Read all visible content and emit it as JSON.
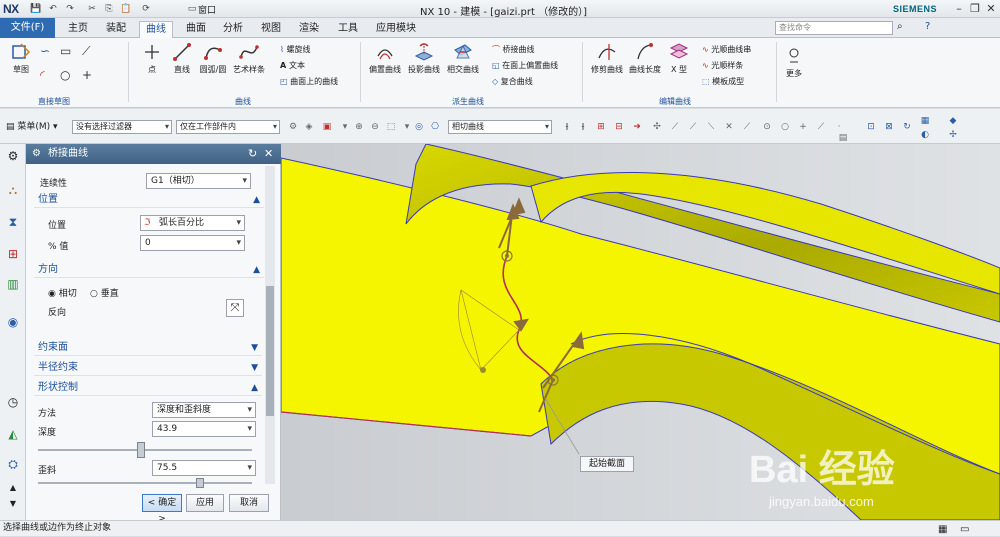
{
  "app": {
    "logo": "NX",
    "window_title": "NX 10 - 建模 - [gaizi.prt （修改的）]",
    "brand": "SIEMENS",
    "window_menu": "窗口",
    "quick_access": [
      "save-icon",
      "undo-icon",
      "redo-icon",
      "cut-icon",
      "copy-icon",
      "paste-icon",
      "repeat-icon",
      "window-icon"
    ]
  },
  "menu": {
    "file": "文件(F)",
    "tabs": [
      "主页",
      "装配",
      "曲线",
      "曲面",
      "分析",
      "视图",
      "渲染",
      "工具",
      "应用模块"
    ],
    "active_tab": "曲线",
    "search_placeholder": "查找命令"
  },
  "ribbon": {
    "sketch": {
      "label": "草图",
      "group": "直接草图"
    },
    "curve_group": {
      "label": "曲线",
      "buttons": [
        "点",
        "直线",
        "圆弧/圆",
        "艺术样条"
      ],
      "small": [
        "螺旋线",
        "文本",
        "曲面上的曲线"
      ]
    },
    "derived_group": {
      "label": "派生曲线",
      "buttons": [
        "偏置曲线",
        "投影曲线",
        "相交曲线"
      ],
      "small": [
        "桥接曲线",
        "在面上偏置曲线",
        "复合曲线"
      ]
    },
    "edit_group": {
      "label": "编辑曲线",
      "buttons": [
        "修剪曲线",
        "曲线长度",
        "X 型"
      ],
      "small": [
        "光顺曲线串",
        "光顺样条",
        "模板成型"
      ]
    },
    "more": "更多"
  },
  "toolbar": {
    "menu": "菜单(M)",
    "filter": "没有选择过滤器",
    "scope": "仅在工作部件内",
    "curve_rule": "相切曲线"
  },
  "panel": {
    "title": "桥接曲线",
    "continuity_label": "连续性",
    "continuity_value": "G1（相切）",
    "position_section": "位置",
    "position_label": "位置",
    "position_value": "弧长百分比",
    "percent_label": "% 值",
    "percent_value": "0",
    "direction_section": "方向",
    "radio_tangent": "相切",
    "radio_normal": "垂直",
    "reverse_label": "反向",
    "constraint_face": "约束面",
    "radius_constraint": "半径约束",
    "shape_control": "形状控制",
    "method_label": "方法",
    "method_value": "深度和歪斜度",
    "depth_label": "深度",
    "depth_value": "43.9",
    "depth_slider": 0.48,
    "skew_label": "歪斜",
    "skew_value": "75.5",
    "skew_slider": 0.755,
    "ok": "< 确定 >",
    "apply": "应用",
    "cancel": "取消"
  },
  "viewport": {
    "callout": "起始截面",
    "watermark_text": "Bai 经验",
    "watermark_url": "jingyan.baidu.com",
    "colors": {
      "surface": "#f5f500",
      "surface_dark": "#b8b800",
      "background": "#cfd2d6",
      "curve": "#b0305a",
      "edge": "#3a3ab8"
    }
  },
  "status": {
    "message": "选择曲线或边作为终止对象"
  }
}
